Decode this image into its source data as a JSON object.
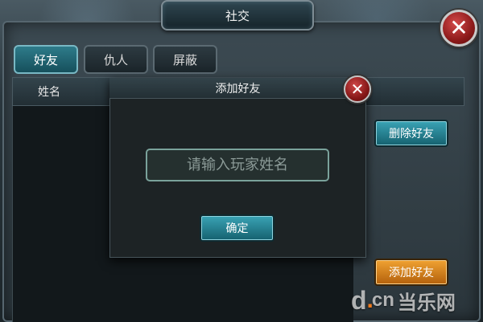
{
  "window": {
    "title": "社交",
    "close_glyph": "✕"
  },
  "tabs": [
    {
      "label": "好友",
      "active": true
    },
    {
      "label": "仇人",
      "active": false
    },
    {
      "label": "屏蔽",
      "active": false
    }
  ],
  "list": {
    "columns": [
      "姓名"
    ]
  },
  "actions": {
    "delete_friend": "删除好友",
    "add_friend": "添加好友"
  },
  "dialog": {
    "title": "添加好友",
    "close_glyph": "✕",
    "input_placeholder": "请输入玩家姓名",
    "input_value": "",
    "confirm_label": "确定"
  },
  "watermark": {
    "d": "d",
    "dot": ".",
    "cn": "cn",
    "text": "当乐网"
  },
  "colors": {
    "tab_active": "#2e7b8a",
    "button_teal": "#15616f",
    "button_orange": "#b3600c",
    "close_red": "#8d1a1a"
  },
  "icons": {
    "window_close": "close-icon",
    "dialog_close": "close-icon"
  }
}
